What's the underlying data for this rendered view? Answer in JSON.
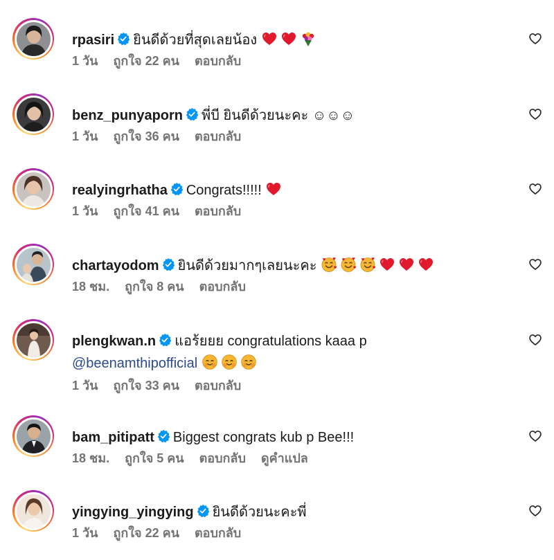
{
  "comments": [
    {
      "username": "rpasiri",
      "text": "ยินดีด้วยที่สุดเลยน้อง",
      "emojis": [
        "red-heart",
        "red-heart",
        "bouquet"
      ],
      "time": "1 วัน",
      "likes": "ถูกใจ 22 คน",
      "reply": "ตอบกลับ"
    },
    {
      "username": "benz_punyaporn",
      "text": "พี่บี ยินดีด้วยนะคะ ☺☺☺",
      "time": "1 วัน",
      "likes": "ถูกใจ 36 คน",
      "reply": "ตอบกลับ"
    },
    {
      "username": "realyingrhatha",
      "text": "Congrats!!!!!",
      "emojis": [
        "red-heart"
      ],
      "time": "1 วัน",
      "likes": "ถูกใจ 41 คน",
      "reply": "ตอบกลับ"
    },
    {
      "username": "chartayodom",
      "text": "ยินดีด้วยมากๆเลยนะคะ",
      "emojis": [
        "smiling-hearts-face",
        "smiling-hearts-face",
        "smiling-hearts-face",
        "red-heart",
        "red-heart",
        "red-heart"
      ],
      "time": "18 ชม.",
      "likes": "ถูกใจ 8 คน",
      "reply": "ตอบกลับ"
    },
    {
      "username": "plengkwan.n",
      "text": "แอร้ยยย congratulations kaaa p",
      "mention": "@beenamthipofficial",
      "emojis": [
        "blushing-face",
        "blushing-face",
        "blushing-face"
      ],
      "time": "1 วัน",
      "likes": "ถูกใจ 33 คน",
      "reply": "ตอบกลับ"
    },
    {
      "username": "bam_pitipatt",
      "text": "Biggest congrats kub p Bee!!!",
      "time": "18 ชม.",
      "likes": "ถูกใจ 5 คน",
      "reply": "ตอบกลับ",
      "translate": "ดูคำแปล"
    },
    {
      "username": "yingying_yingying",
      "text": "ยินดีด้วยนะคะพี่",
      "time": "1 วัน",
      "likes": "ถูกใจ 22 คน",
      "reply": "ตอบกลับ"
    }
  ],
  "colors": {
    "verified": "#0095f6",
    "meta_text": "#737373",
    "mention": "#2d4a8a",
    "heart_emoji": "#e0192c",
    "face_emoji": "#f7b733"
  }
}
